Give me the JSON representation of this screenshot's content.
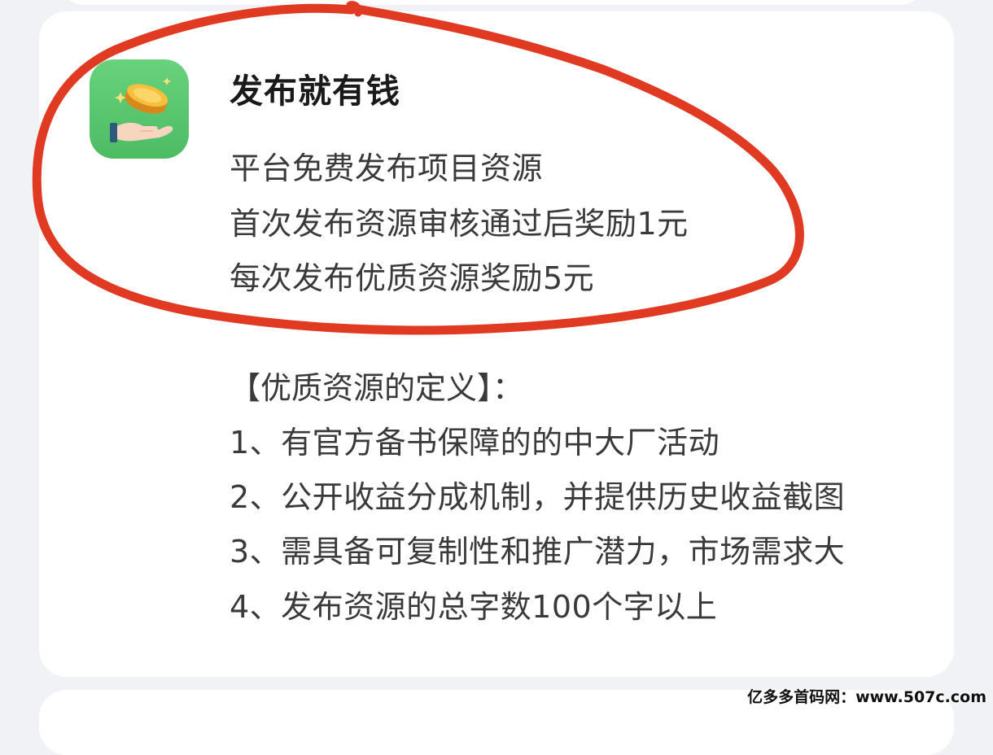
{
  "card": {
    "icon": "coin-hand-icon",
    "title": "发布就有钱",
    "lines": [
      "平台免费发布项目资源",
      "首次发布资源审核通过后奖励1元",
      "每次发布优质资源奖励5元"
    ],
    "definition_heading": "【优质资源的定义】：",
    "rules": [
      "1、有官方备书保障的的中大厂活动",
      "2、公开收益分成机制，并提供历史收益截图",
      "3、需具备可复制性和推广潜力，市场需求大",
      "4、发布资源的总字数100个字以上"
    ]
  },
  "watermark": "亿多多首码网：www.507c.com",
  "colors": {
    "icon_green": "#55c46b",
    "annotation_red": "#e03a22",
    "coin_gold": "#f5b93a"
  }
}
